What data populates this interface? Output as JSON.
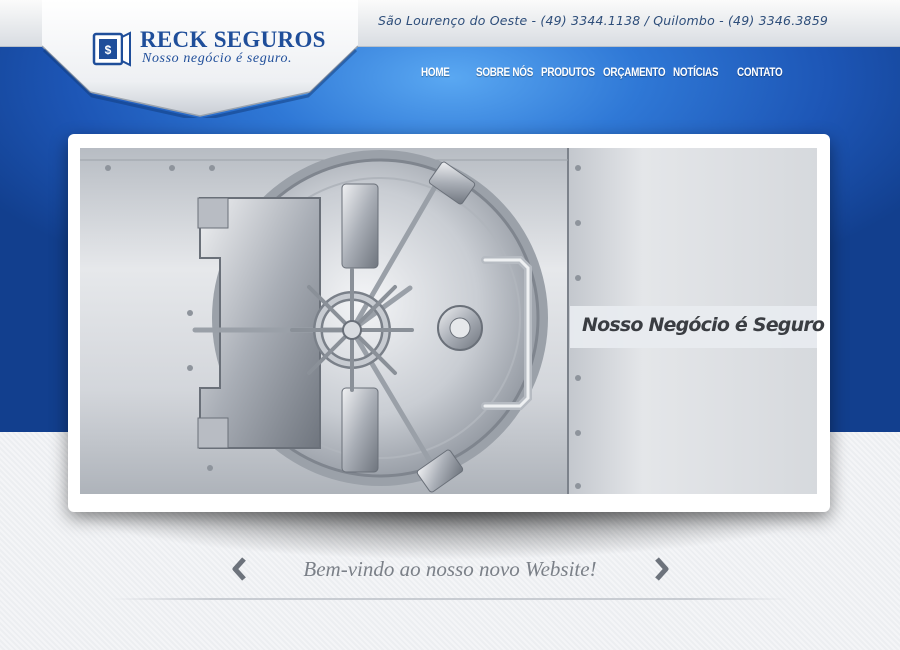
{
  "header": {
    "contact": "São Lourenço do Oeste - (49) 3344.1138 / Quilombo - (49) 3346.3859",
    "logo": {
      "name": "RECK SEGUROS",
      "slogan": "Nosso negócio é seguro.",
      "icon": "safe-icon"
    }
  },
  "nav": {
    "items": [
      {
        "label": "HOME"
      },
      {
        "label": "SOBRE NÓS"
      },
      {
        "label": "PRODUTOS"
      },
      {
        "label": "ORÇAMENTO"
      },
      {
        "label": "NOTÍCIAS"
      },
      {
        "label": "CONTATO"
      }
    ]
  },
  "slider": {
    "caption": "Nosso Negócio é Seguro",
    "image": "bank-vault-door",
    "prev_icon": "chevron-left-icon",
    "next_icon": "chevron-right-icon"
  },
  "welcome": {
    "text": "Bem-vindo ao nosso novo Website!"
  },
  "colors": {
    "brand_blue": "#1f4e9a",
    "header_blue": "#2f78d6",
    "contact_text": "#2e4e7a",
    "welcome_text": "#7b8088"
  }
}
